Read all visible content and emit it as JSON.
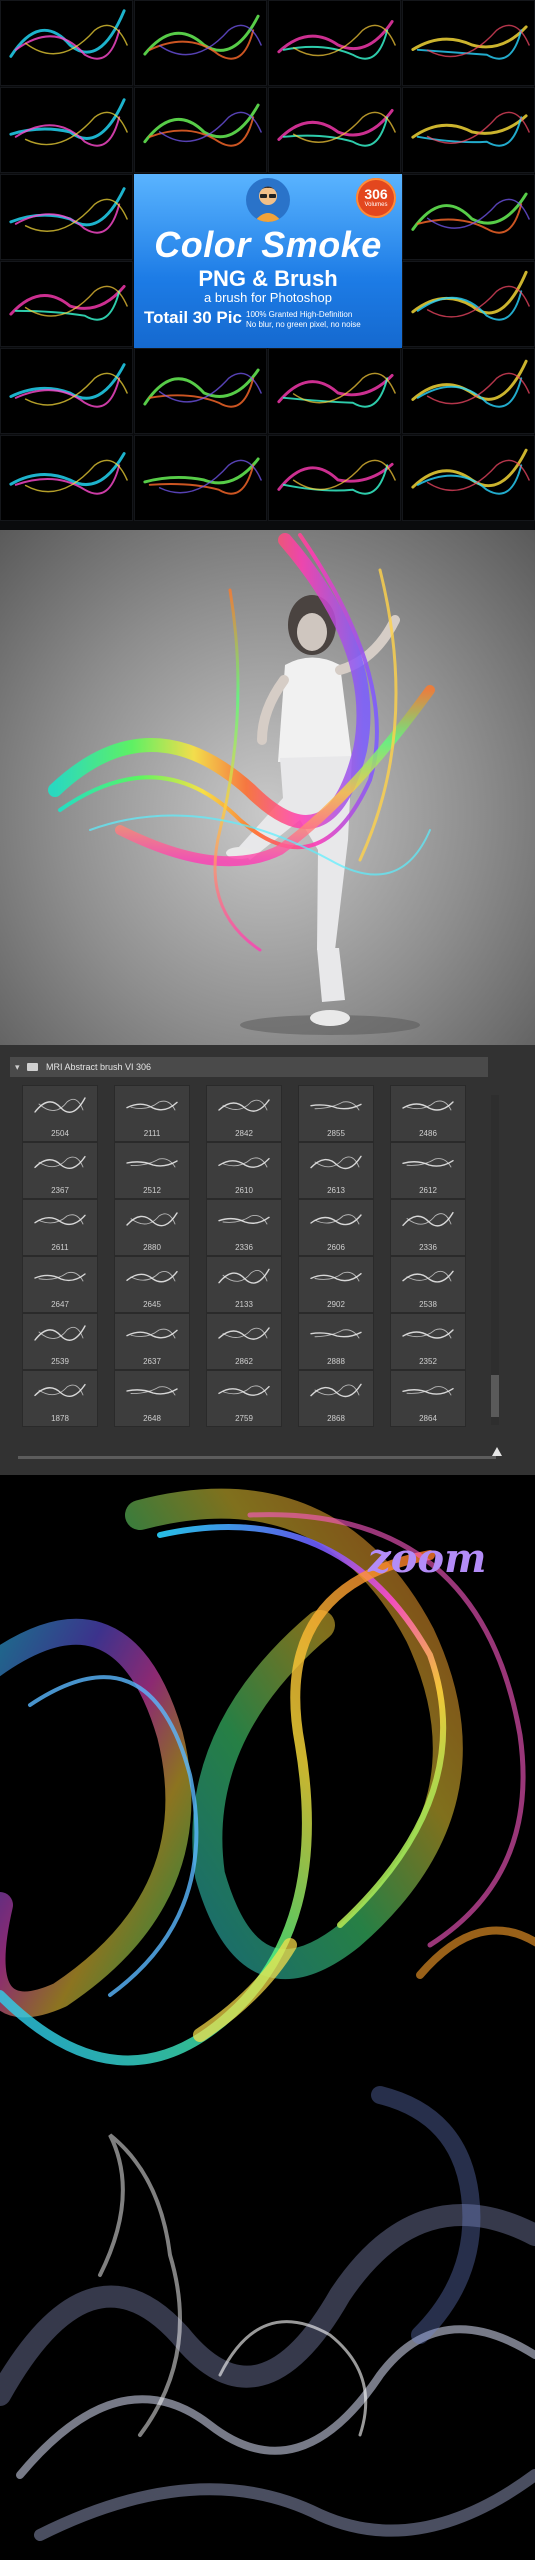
{
  "banner": {
    "badge_number": "306",
    "badge_sub": "Volumes",
    "title": "Color Smoke",
    "subtitle": "PNG & Brush",
    "tagline": "a brush for Photoshop",
    "count": "Totail 30 Pic",
    "features": [
      "100% Granted High-Definition",
      "No blur, no green pixel, no noise"
    ]
  },
  "panel": {
    "group_name": "MRI Abstract brush VI 306",
    "brushes": [
      "2504",
      "2111",
      "2842",
      "2855",
      "2486",
      "2367",
      "2512",
      "2610",
      "2613",
      "2612",
      "2611",
      "2880",
      "2336",
      "2606",
      "2336",
      "2647",
      "2645",
      "2133",
      "2902",
      "2538",
      "2539",
      "2637",
      "2862",
      "2888",
      "2352",
      "1878",
      "2648",
      "2759",
      "2868",
      "2864"
    ]
  },
  "zoom": {
    "label": "zoom"
  },
  "colors": {
    "banner_blue": "#1d7ce6",
    "badge_red": "#e3471e",
    "panel_bg": "#323232",
    "zoom_purple": "#b38cf7"
  }
}
